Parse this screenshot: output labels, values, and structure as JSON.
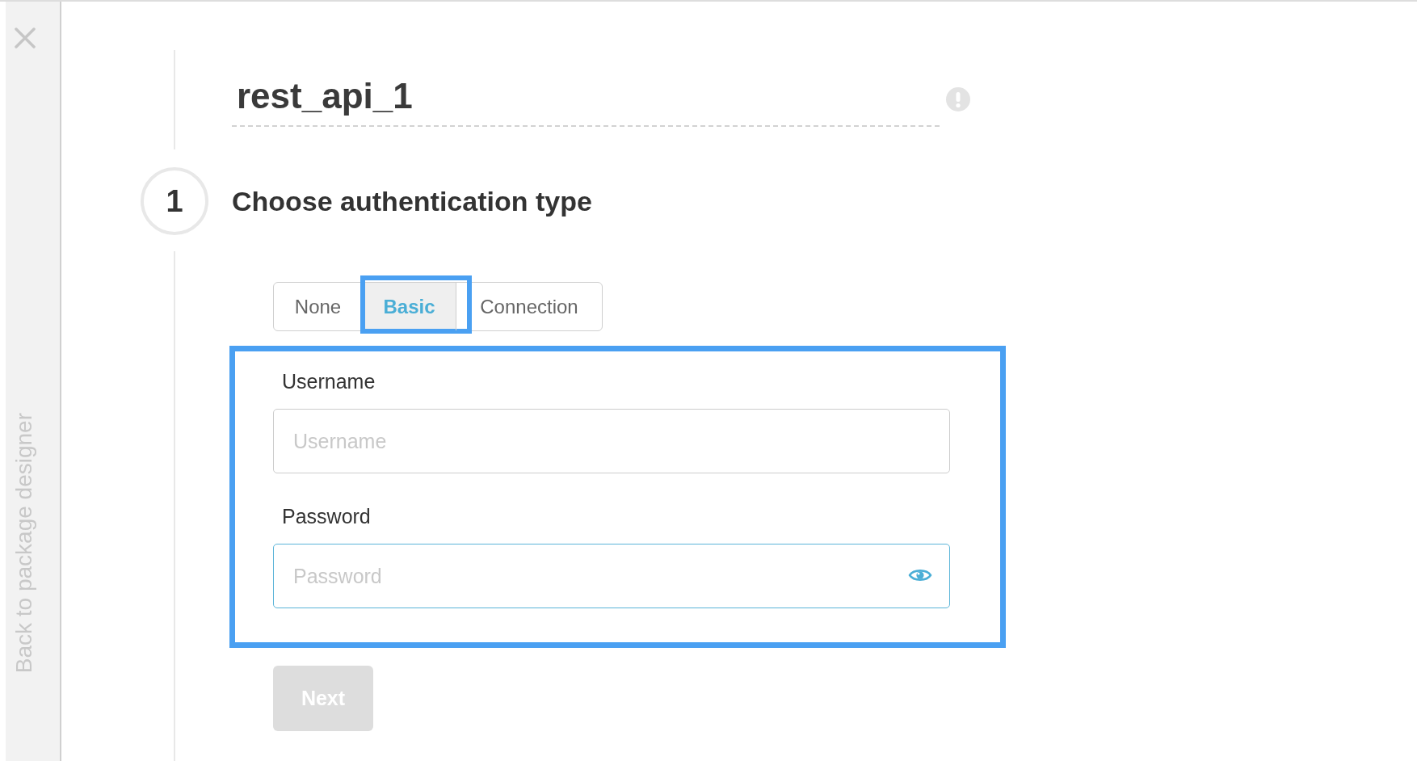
{
  "sidebar": {
    "back_link": "Back to package designer"
  },
  "title": "rest_api_1",
  "step": {
    "number": "1",
    "heading": "Choose authentication type"
  },
  "tabs": [
    {
      "label": "None",
      "selected": false,
      "highlighted": false
    },
    {
      "label": "Basic",
      "selected": true,
      "highlighted": true
    },
    {
      "label": "Connection",
      "selected": false,
      "highlighted": false
    }
  ],
  "credentials": {
    "highlighted": true,
    "fields": [
      {
        "kind": "text",
        "label": "Username",
        "placeholder": "Username",
        "focused": false
      },
      {
        "kind": "password",
        "label": "Password",
        "placeholder": "Password",
        "focused": true
      }
    ]
  },
  "next_button": {
    "label": "Next",
    "disabled": true
  }
}
